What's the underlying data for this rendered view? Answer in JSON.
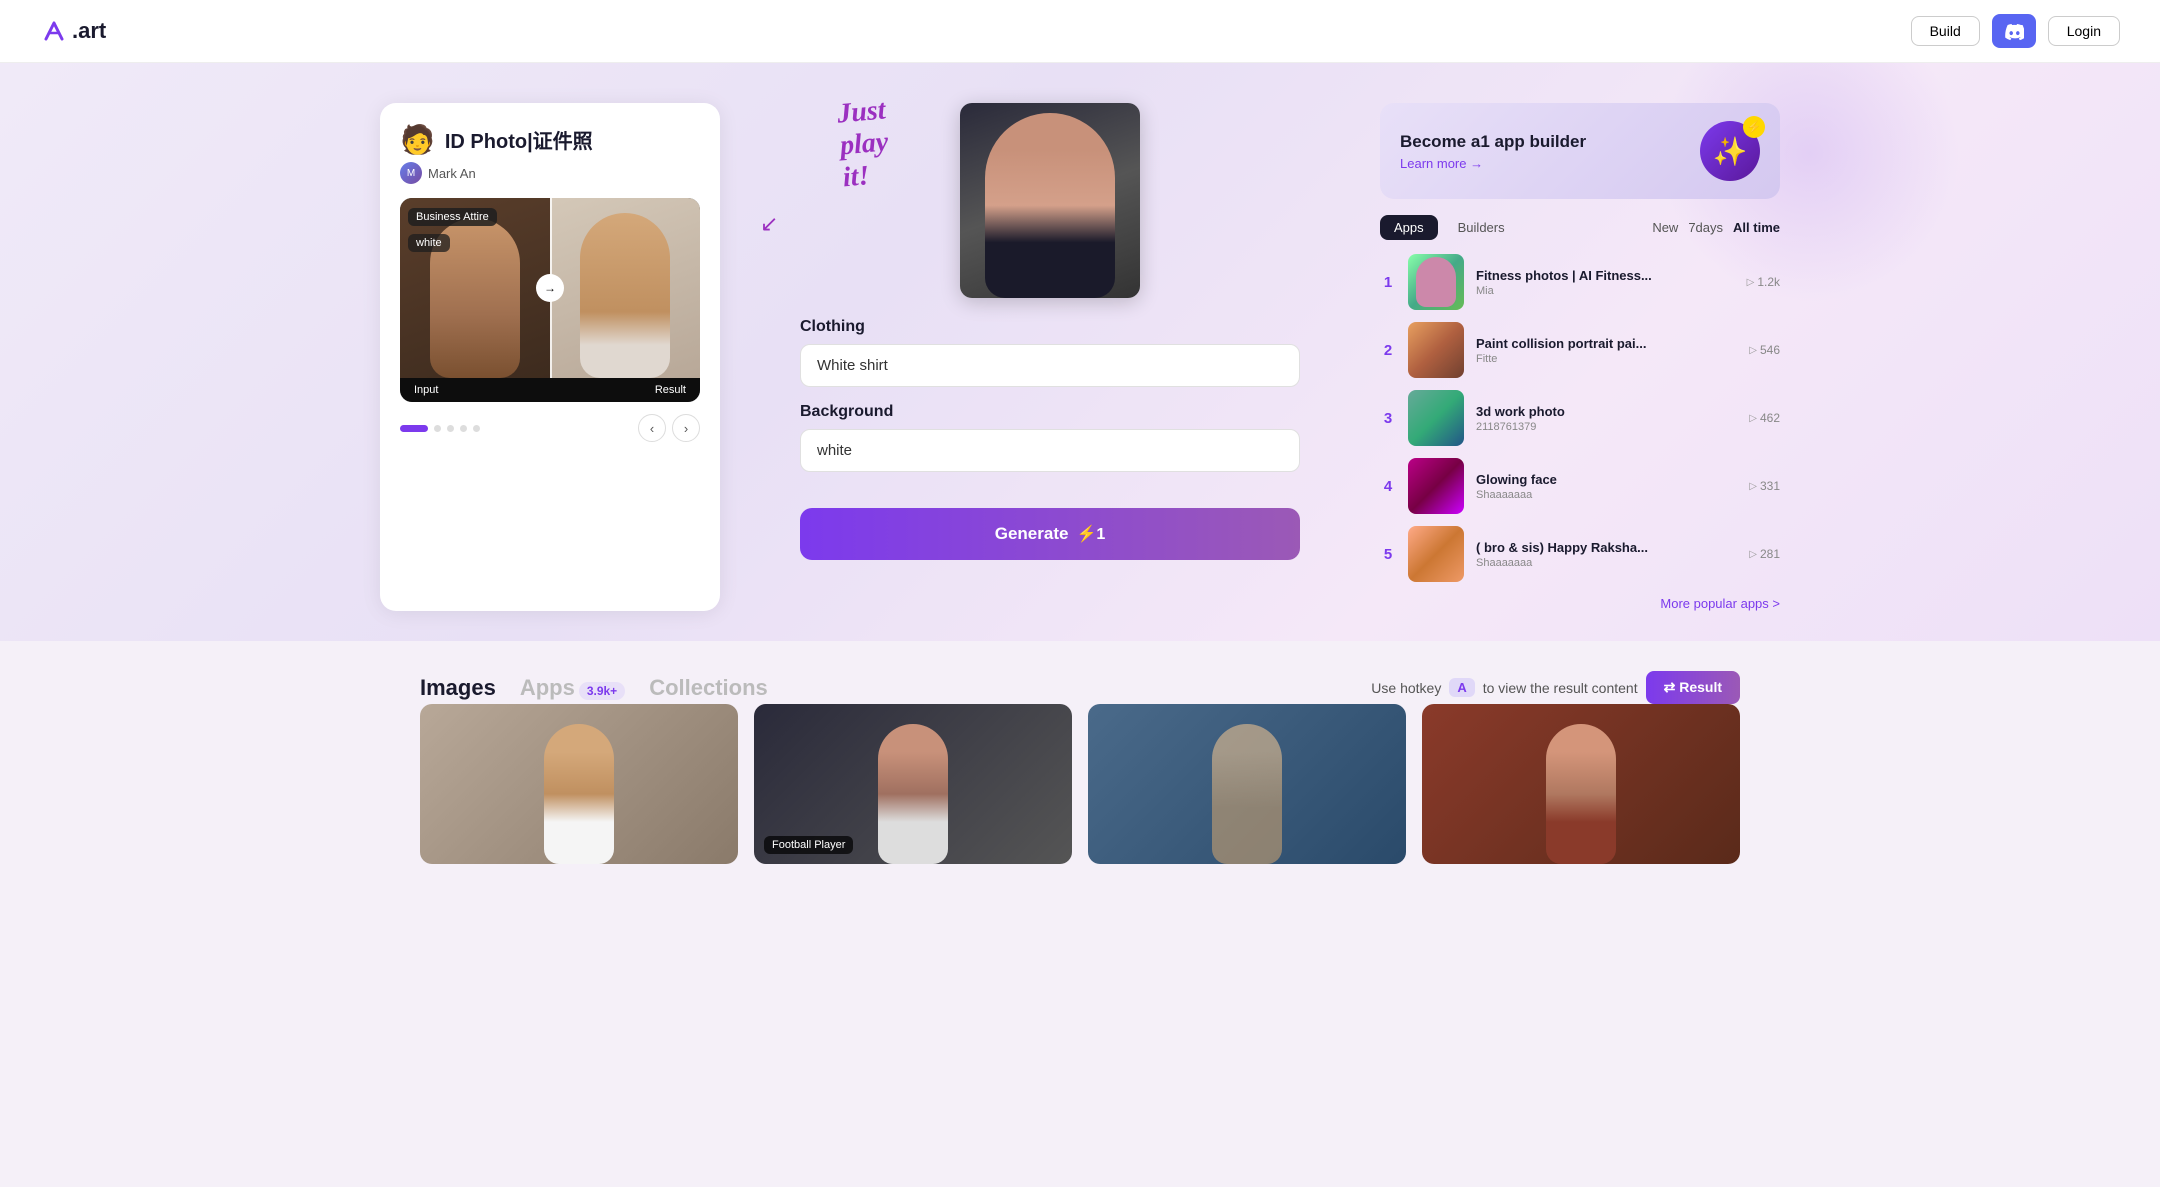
{
  "navbar": {
    "logo_text": ".art",
    "build_label": "Build",
    "login_label": "Login"
  },
  "hero": {
    "annotation": "Just play it!",
    "left_panel": {
      "app_emoji": "🧑",
      "app_title": "ID Photo|证件照",
      "author_name": "Mark An",
      "badge_business": "Business Attire",
      "badge_white": "white",
      "label_input": "Input",
      "label_result": "Result",
      "dot_count": 5
    },
    "middle_panel": {
      "clothing_label": "Clothing",
      "clothing_value": "White shirt",
      "background_label": "Background",
      "background_value": "white",
      "generate_label": "Generate",
      "generate_cost": "⚡1"
    },
    "right_panel": {
      "promo_title": "Become a1 app builder",
      "promo_link": "Learn more →",
      "tabs": [
        "Apps",
        "Builders"
      ],
      "active_tab": "Apps",
      "time_filters": [
        "New",
        "7days",
        "All time"
      ],
      "active_time": "New",
      "apps": [
        {
          "rank": "1",
          "name": "Fitness photos | AI Fitness...",
          "creator": "Mia",
          "plays": "1.2k"
        },
        {
          "rank": "2",
          "name": "Paint collision portrait pai...",
          "creator": "Fitte",
          "plays": "546"
        },
        {
          "rank": "3",
          "name": "3d work photo",
          "creator": "2118761379",
          "plays": "462"
        },
        {
          "rank": "4",
          "name": "Glowing face",
          "creator": "Shaaaaaaa",
          "plays": "331"
        },
        {
          "rank": "5",
          "name": "( bro & sis) Happy Raksha...",
          "creator": "Shaaaaaaa",
          "plays": "281"
        }
      ],
      "more_label": "More popular apps >"
    }
  },
  "bottom": {
    "tabs": [
      {
        "label": "Images",
        "active": true
      },
      {
        "label": "Apps",
        "active": false,
        "badge": "3.9k+"
      },
      {
        "label": "Collections",
        "active": false
      }
    ],
    "hotkey_prefix": "Use hotkey",
    "hotkey_key": "A",
    "hotkey_suffix": "to view the result content",
    "result_label": "⇄ Result",
    "gallery_items": [
      {
        "label": ""
      },
      {
        "label": "Football Player"
      },
      {
        "label": ""
      },
      {
        "label": ""
      }
    ]
  }
}
